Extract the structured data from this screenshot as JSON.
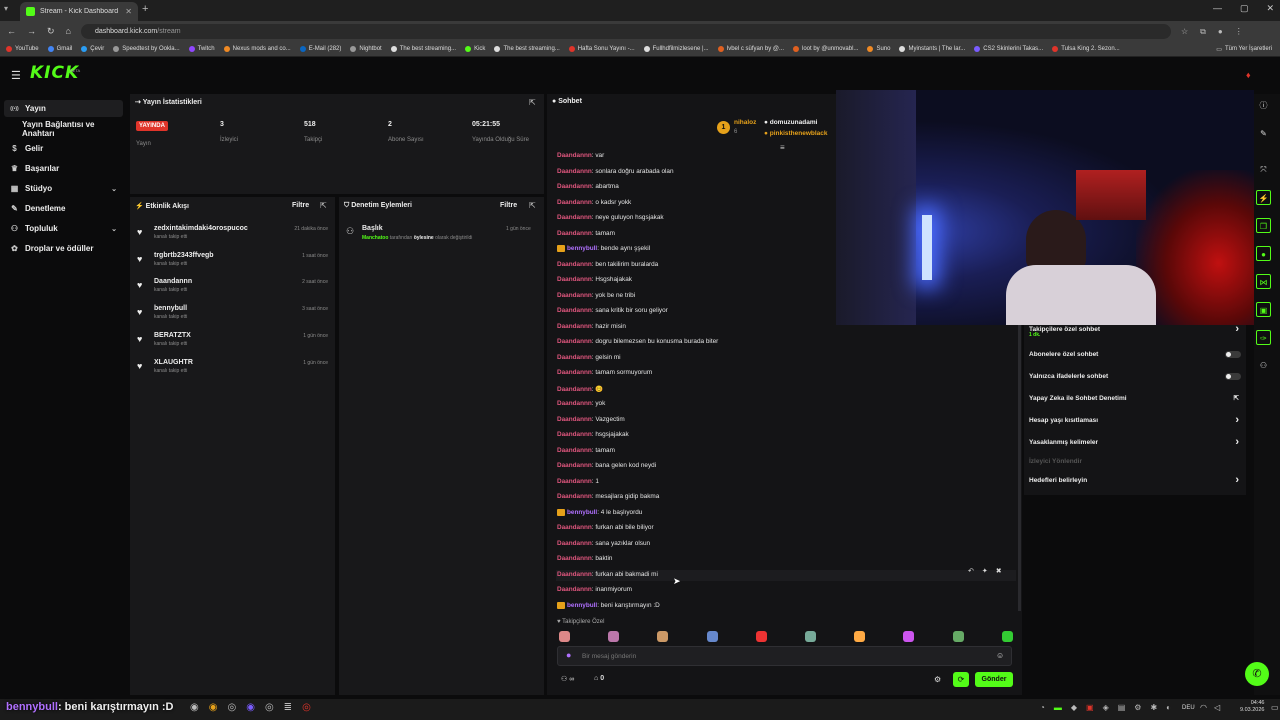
{
  "browser": {
    "tab_title": "Stream - Kick Dashboard",
    "url_host": "dashboard.kick.com",
    "url_path": "/stream",
    "bookmarks": [
      "YouTube",
      "Gmail",
      "Çevir",
      "Speedtest by Ookla...",
      "Twitch",
      "Nexus mods and co...",
      "E-Mail (282)",
      "Nightbot",
      "The best streaming...",
      "Kick",
      "The best streaming...",
      "Hafta Sonu Yayını -...",
      "Fullhdfilmizlesene |...",
      "Ivbel c süfyan by @...",
      "loot by @unmovabl...",
      "Suno",
      "Myinstants | The lar...",
      "CS2 Skinlerini Takas...",
      "Tulsa King 2. Sezon..."
    ],
    "bookmarks_all": "Tüm Yer İşaretleri"
  },
  "app": {
    "logo": "KICK",
    "beta": "BETA"
  },
  "sidenav": [
    {
      "label": "Yayın",
      "icon": "broadcast-icon"
    },
    {
      "label": "Yayın Bağlantısı ve Anahtarı",
      "icon": ""
    },
    {
      "label": "Gelir",
      "icon": "dollar-icon"
    },
    {
      "label": "Başarılar",
      "icon": "trophy-icon"
    },
    {
      "label": "Stüdyo",
      "icon": "studio-icon"
    },
    {
      "label": "Denetleme",
      "icon": "wrench-icon"
    },
    {
      "label": "Topluluk",
      "icon": "community-icon"
    },
    {
      "label": "Droplar ve ödüller",
      "icon": "gift-icon"
    }
  ],
  "stats": {
    "title": "Yayın İstatistikleri",
    "live_badge": "YAYINDA",
    "live_label": "Yayın",
    "items": [
      {
        "value": "3",
        "label": "İzleyici"
      },
      {
        "value": "518",
        "label": "Takipçi"
      },
      {
        "value": "2",
        "label": "Abone Sayısı"
      },
      {
        "value": "05:21:55",
        "label": "Yayında Olduğu Süre"
      }
    ]
  },
  "activity": {
    "title": "Etkinlik Akışı",
    "filter": "Filtre",
    "items": [
      {
        "name": "zedxintakimdaki4orospucoc",
        "sub": "kanalı takip etti",
        "time": "21 dakika önce"
      },
      {
        "name": "trgbrtb2343ffvegb",
        "sub": "kanalı takip etti",
        "time": "1 saat önce"
      },
      {
        "name": "Daandannn",
        "sub": "kanalı takip etti",
        "time": "2 saat önce"
      },
      {
        "name": "bennybull",
        "sub": "kanalı takip etti",
        "time": "3 saat önce"
      },
      {
        "name": "BERATZTX",
        "sub": "kanalı takip etti",
        "time": "1 gün önce"
      },
      {
        "name": "XLAUGHTR",
        "sub": "kanalı takip etti",
        "time": "1 gün önce"
      }
    ]
  },
  "moderation": {
    "title": "Denetim Eylemleri",
    "filter": "Filtre",
    "item_title": "Başlık",
    "item_user": "Manchatoo",
    "item_mid": " tarafından ",
    "item_target": "öylesine",
    "item_end": " olarak değiştirildi",
    "item_time": "1 gün önce"
  },
  "chat": {
    "title": "Sohbet",
    "pinned": [
      {
        "name": "nihaloz",
        "count": "6"
      },
      {
        "name": "domuzunadami"
      },
      {
        "name": "pinkisthenewblack"
      }
    ],
    "messages": [
      {
        "user": "Daandannn",
        "text": "var"
      },
      {
        "user": "Daandannn",
        "text": "sonlara doğru arabada olan"
      },
      {
        "user": "Daandannn",
        "text": "abartma"
      },
      {
        "user": "Daandannn",
        "text": "o kadsr yokk"
      },
      {
        "user": "Daandannn",
        "text": "neye guluyon hsgsjakak"
      },
      {
        "user": "Daandannn",
        "text": "tamam"
      },
      {
        "user": "bennybull",
        "text": "bende aynı şşekil",
        "crown": true
      },
      {
        "user": "Daandannn",
        "text": "ben takilirim buralarda"
      },
      {
        "user": "Daandannn",
        "text": "Hsgshajakak"
      },
      {
        "user": "Daandannn",
        "text": "yok be ne tribi"
      },
      {
        "user": "Daandannn",
        "text": "sana kritik bir soru geliyor"
      },
      {
        "user": "Daandannn",
        "text": "hazir misin"
      },
      {
        "user": "Daandannn",
        "text": "dogru bilemezsen bu konusma burada biter"
      },
      {
        "user": "Daandannn",
        "text": "gelsin mi"
      },
      {
        "user": "Daandannn",
        "text": "tamam sormuyorum"
      },
      {
        "user": "Daandannn",
        "text": "😊"
      },
      {
        "user": "Daandannn",
        "text": "yok"
      },
      {
        "user": "Daandannn",
        "text": "Vazgectim"
      },
      {
        "user": "Daandannn",
        "text": "hsgsjajakak"
      },
      {
        "user": "Daandannn",
        "text": "tamam"
      },
      {
        "user": "Daandannn",
        "text": "bana gelen kod neydi"
      },
      {
        "user": "Daandannn",
        "text": "1"
      },
      {
        "user": "Daandannn",
        "text": "mesajlara gidip bakma"
      },
      {
        "user": "bennybull",
        "text": "4 le başlıyordu",
        "crown": true
      },
      {
        "user": "Daandannn",
        "text": "furkan abi bile biliyor"
      },
      {
        "user": "Daandannn",
        "text": "sana yazıklar olsun"
      },
      {
        "user": "Daandannn",
        "text": "baktin"
      },
      {
        "user": "Daandannn",
        "text": "furkan abi bakmadi mi"
      },
      {
        "user": "Daandannn",
        "text": "inanmiyorum"
      },
      {
        "user": "bennybull",
        "text": "beni karıştırmayın :D",
        "crown": true
      }
    ],
    "followers_only": "Takipçilere Özel",
    "input_placeholder": "Bir mesaj gönderin",
    "count_a": "∞",
    "count_b": "0",
    "send": "Gönder"
  },
  "settings": [
    {
      "label": "Takipçilere özel sohbet",
      "sub": "1 dk.",
      "control": "chevron"
    },
    {
      "label": "Abonelere özel sohbet",
      "control": "toggle"
    },
    {
      "label": "Yalnızca ifadelerle sohbet",
      "control": "toggle"
    },
    {
      "label": "Yapay Zeka ile Sohbet Denetimi",
      "control": "external"
    },
    {
      "label": "Hesap yaşı kısıtlaması",
      "control": "chevron"
    },
    {
      "label": "Yasaklanmış kelimeler",
      "control": "chevron"
    },
    {
      "label": "İzleyici Yönlendir",
      "control": "none",
      "disabled": true
    },
    {
      "label": "Hedefleri belirleyin",
      "control": "chevron"
    }
  ],
  "taskbar": {
    "overlay_user": "bennybull",
    "overlay_text": ": beni karıştırmayın :D",
    "lang": "DEU",
    "time": "04:46",
    "date": "9.03.2026"
  },
  "colors": {
    "accent": "#53fc18",
    "live": "#e0342a",
    "chat_user": "#e0567e",
    "sub_user": "#b070ff"
  }
}
